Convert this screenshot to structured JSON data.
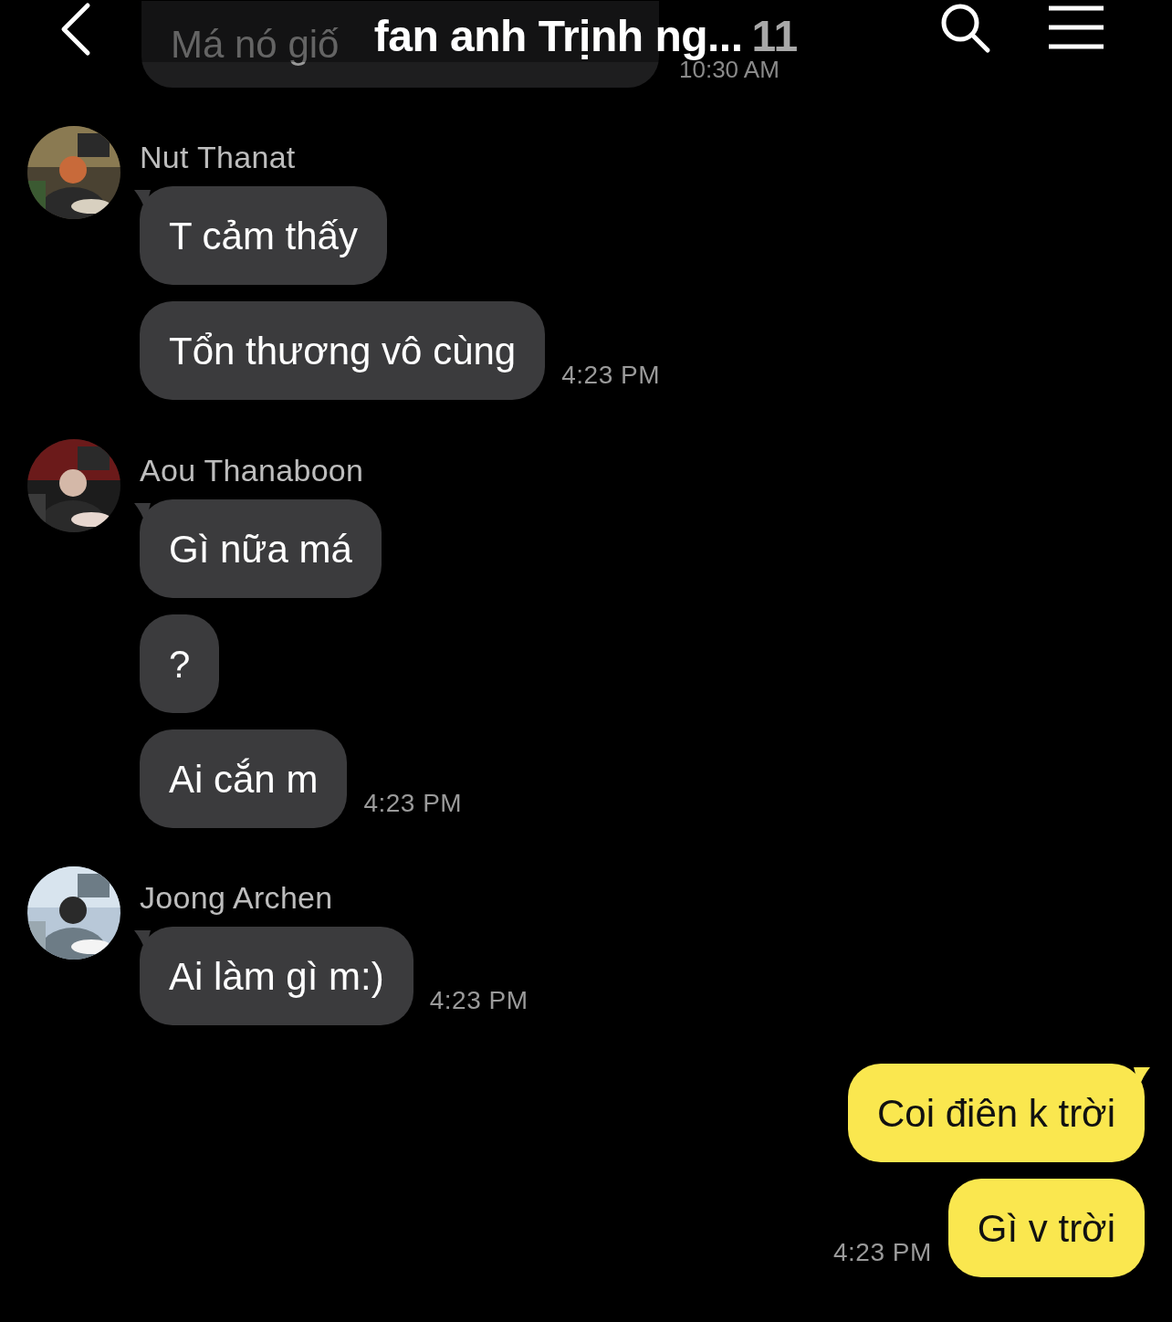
{
  "header": {
    "title": "fan anh Trịnh ng...",
    "member_count": "11"
  },
  "faded_message": {
    "text": "Má nó giố",
    "time": "10:30 AM"
  },
  "messages": [
    {
      "kind": "incoming",
      "sender": "Nut Thanat",
      "bubbles": [
        "T cảm thấy",
        "Tổn thương vô cùng"
      ],
      "time": "4:23 PM"
    },
    {
      "kind": "incoming",
      "sender": "Aou Thanaboon",
      "bubbles": [
        "Gì nữa má",
        "?",
        "Ai cắn m"
      ],
      "time": "4:23 PM"
    },
    {
      "kind": "incoming",
      "sender": "Joong Archen",
      "bubbles": [
        "Ai làm gì m:)"
      ],
      "time": "4:23 PM"
    },
    {
      "kind": "outgoing",
      "bubbles": [
        "Coi điên k trời",
        "Gì v trời"
      ],
      "time": "4:23 PM"
    }
  ]
}
